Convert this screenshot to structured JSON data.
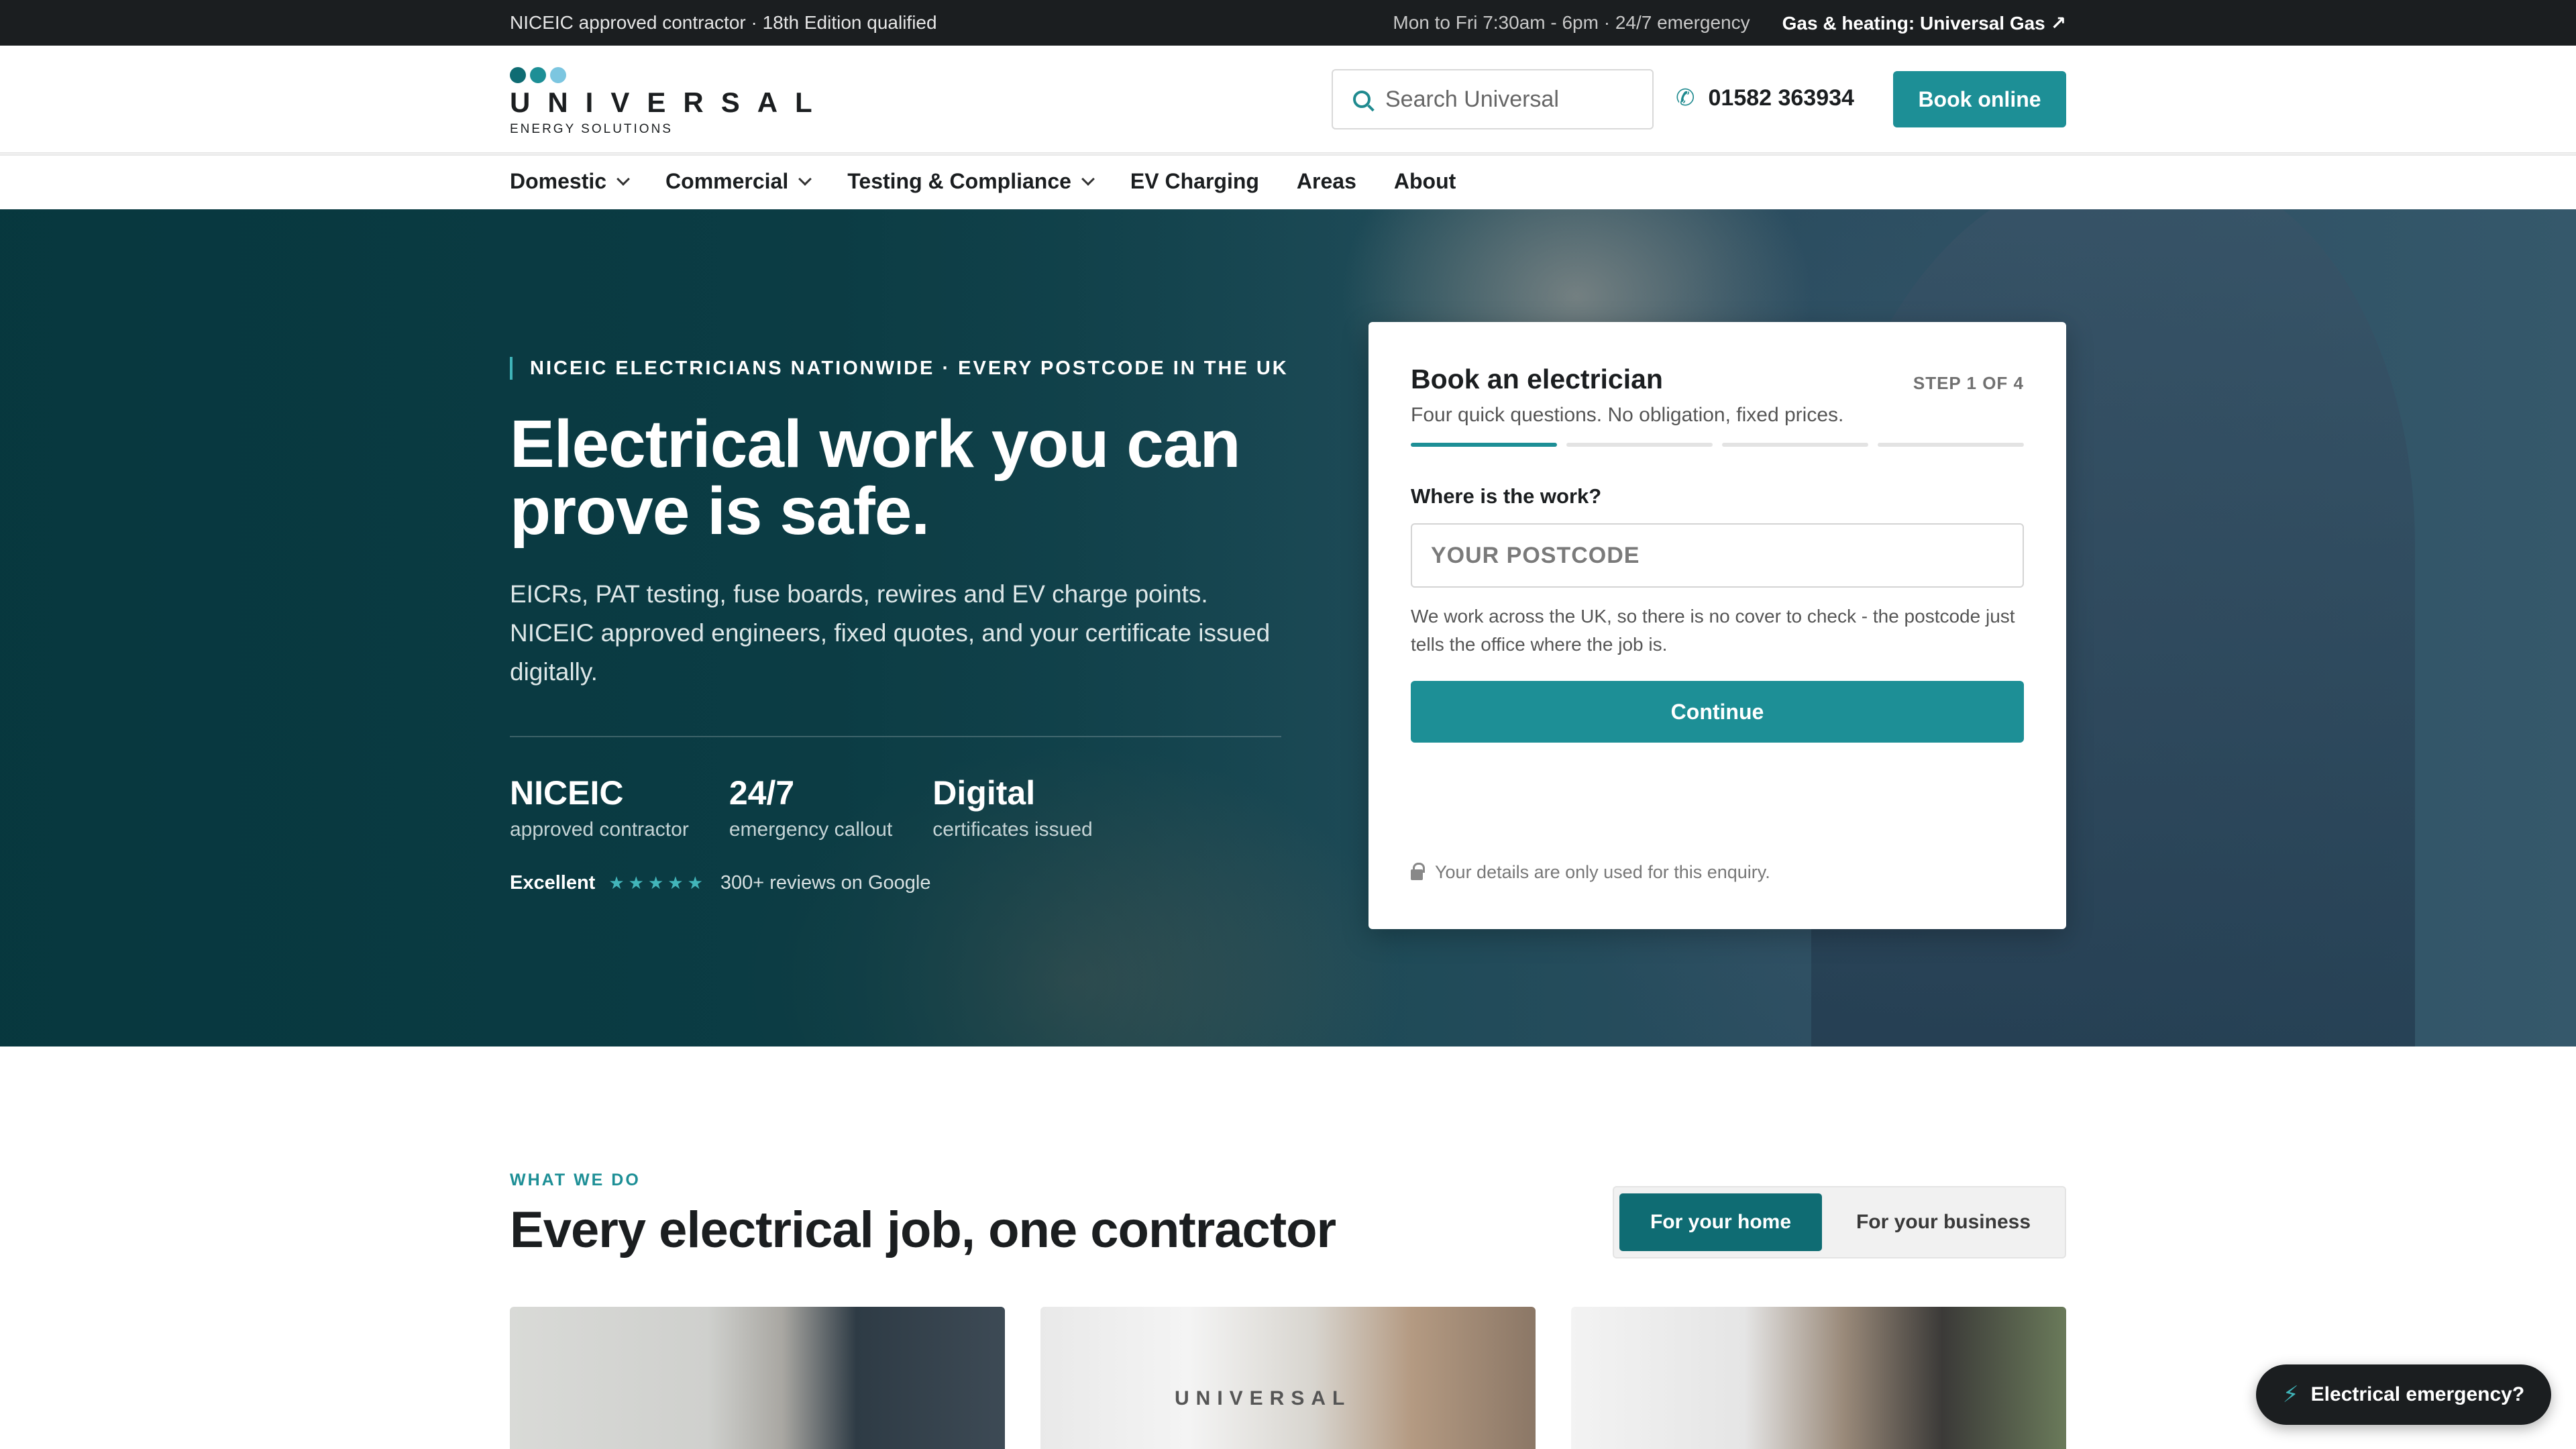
{
  "topbar": {
    "left_text": "NICEIC approved contractor · 18th Edition qualified",
    "hours": "Mon to Fri 7:30am - 6pm · 24/7 emergency",
    "gas_link": "Gas & heating: Universal Gas ↗"
  },
  "header": {
    "logo_word": "UNIVERSAL",
    "logo_sub": "ENERGY SOLUTIONS",
    "logo_dots": [
      "#0f6c73",
      "#1d8f96",
      "#7cc6e0"
    ],
    "search_placeholder": "Search Universal",
    "phone": "01582 363934",
    "book_label": "Book online"
  },
  "nav": {
    "items": [
      {
        "label": "Domestic",
        "has_dropdown": true
      },
      {
        "label": "Commercial",
        "has_dropdown": true
      },
      {
        "label": "Testing & Compliance",
        "has_dropdown": true
      },
      {
        "label": "EV Charging",
        "has_dropdown": false
      },
      {
        "label": "Areas",
        "has_dropdown": false
      },
      {
        "label": "About",
        "has_dropdown": false
      }
    ]
  },
  "hero": {
    "eyebrow": "NICEIC ELECTRICIANS NATIONWIDE · EVERY POSTCODE IN THE UK",
    "title": "Electrical work you can prove is safe.",
    "subtitle": "EICRs, PAT testing, fuse boards, rewires and EV charge points. NICEIC approved engineers, fixed quotes, and your certificate issued digitally.",
    "stats": [
      {
        "value": "NICEIC",
        "label": "approved contractor"
      },
      {
        "value": "24/7",
        "label": "emergency callout"
      },
      {
        "value": "Digital",
        "label": "certificates issued"
      }
    ],
    "rating_word": "Excellent",
    "rating_stars": "★★★★★",
    "rating_count": "300+ reviews on Google"
  },
  "booking": {
    "title": "Book an electrician",
    "step": "STEP 1 OF 4",
    "subtitle": "Four quick questions. No obligation, fixed prices.",
    "steps_total": 4,
    "steps_done": 1,
    "question": "Where is the work?",
    "postcode_placeholder": "YOUR POSTCODE",
    "help_text": "We work across the UK, so there is no cover to check - the postcode just tells the office where the job is.",
    "continue_label": "Continue",
    "privacy": "Your details are only used for this enquiry."
  },
  "services": {
    "eyebrow": "WHAT WE DO",
    "title": "Every electrical job, one contractor",
    "toggle_home": "For your home",
    "toggle_business": "For your business",
    "photo_van_text": "UNIVERSAL"
  },
  "emergency_label": "Electrical emergency?",
  "colors": {
    "accent": "#1d8f96",
    "accent_dark": "#0f6c73",
    "topbar": "#1b1e20"
  }
}
